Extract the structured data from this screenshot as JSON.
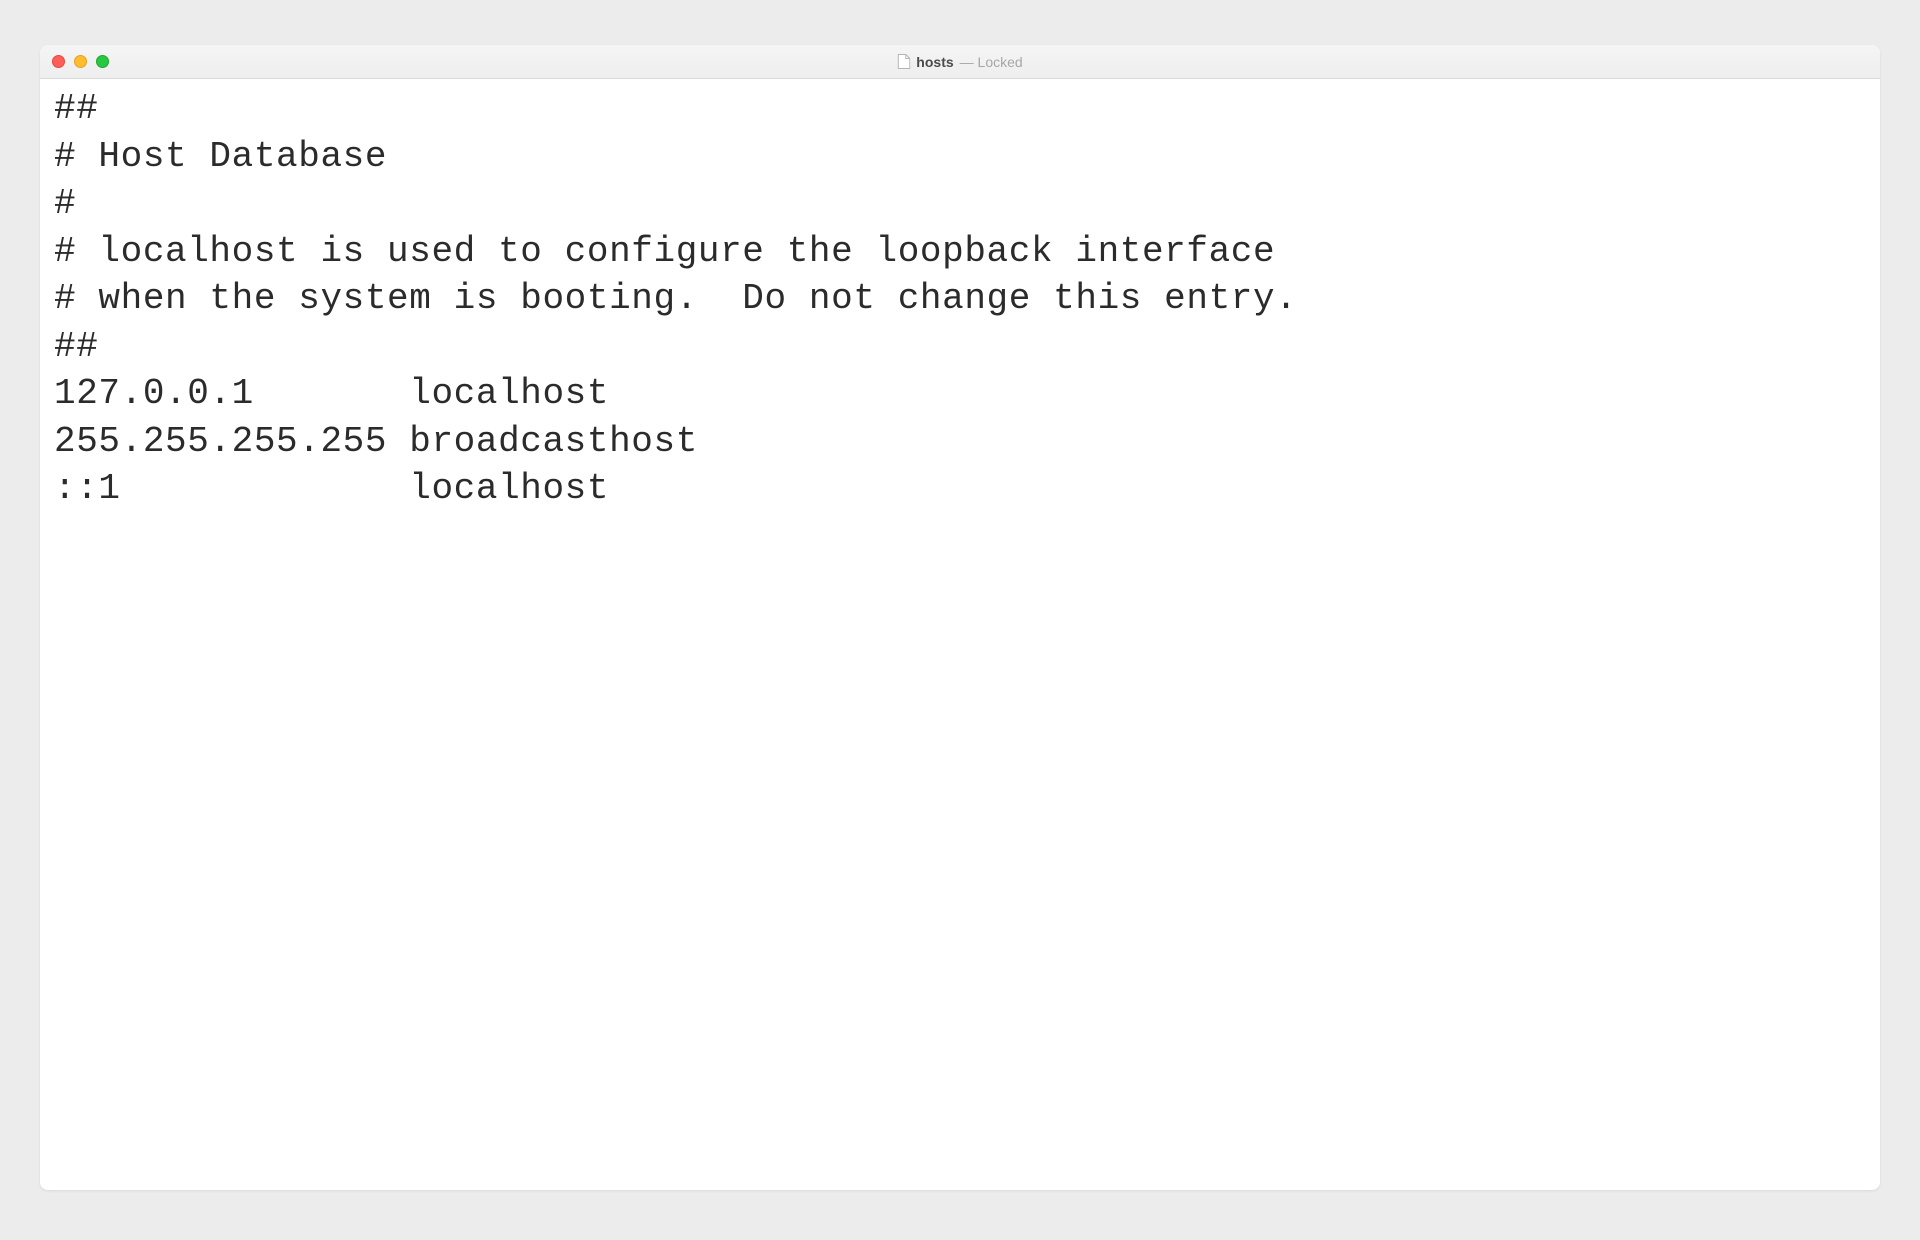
{
  "titlebar": {
    "filename": "hosts",
    "separator": " — ",
    "status": "Locked"
  },
  "editor": {
    "content": "##\n# Host Database\n#\n# localhost is used to configure the loopback interface\n# when the system is booting.  Do not change this entry.\n##\n127.0.0.1       localhost\n255.255.255.255 broadcasthost\n::1             localhost"
  }
}
